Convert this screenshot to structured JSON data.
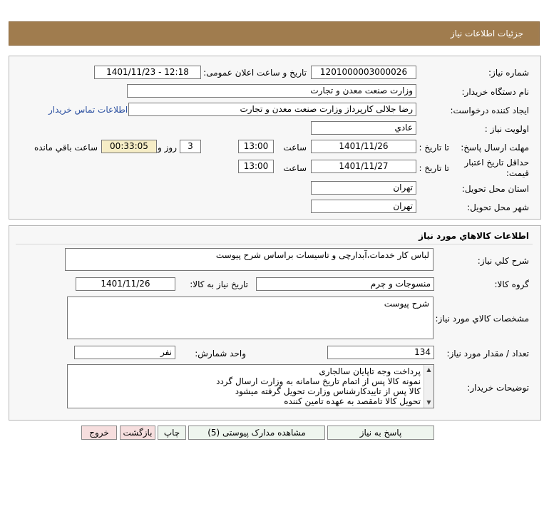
{
  "header": {
    "title": "جزئیات اطلاعات نیاز"
  },
  "details": {
    "need_number_label": "شماره نیاز:",
    "need_number": "1201000003000026",
    "announce_label": "تاریخ و ساعت اعلان عمومی:",
    "announce_value": "1401/11/23 - 12:18",
    "buyer_org_label": "نام دستگاه خریدار:",
    "buyer_org": "وزارت صنعت معدن و تجارت",
    "requester_label": "ایجاد کننده درخواست:",
    "requester": "رضا جلالی کارپرداز وزارت صنعت معدن و تجارت",
    "contact_link": "اطلاعات تماس خریدار",
    "priority_label": "اولویت نیاز :",
    "priority": "عادي",
    "deadline_label": "مهلت ارسال پاسخ:",
    "to_date_label": "تا تاریخ :",
    "deadline_date": "1401/11/26",
    "time_label": "ساعت",
    "deadline_time": "13:00",
    "days_value": "3",
    "days_label": "روز و",
    "remaining_time": "00:33:05",
    "remaining_label": "ساعت باقي مانده",
    "validity_label_1": "حداقل تاریخ اعتبار",
    "validity_label_2": "قیمت:",
    "validity_to_label": "تا تاریخ :",
    "validity_date": "1401/11/27",
    "validity_time_label": "ساعت",
    "validity_time": "13:00",
    "province_label": "استان محل تحویل:",
    "province": "تهران",
    "city_label": "شهر محل تحویل:",
    "city": "تهران"
  },
  "goods": {
    "section_title": "اطلاعات کالاهاي مورد نياز",
    "summary_label": "شرح کلي نياز:",
    "summary": "لباس کار خدمات،آبدارچی و تاسیسات براساس شرح پیوست",
    "group_label": "گروه کالا:",
    "group": "منسوجات و چرم",
    "need_date_label": "تاریخ نیاز به کالا:",
    "need_date": "1401/11/26",
    "specs_label": "مشخصات کالاي مورد نياز:",
    "specs": "شرح پیوست",
    "qty_label": "تعداد / مقدار مورد نیاز:",
    "qty": "134",
    "unit_label": "واحد شمارش:",
    "unit": "نفر",
    "buyer_notes_label": "توضیحات خریدار:",
    "buyer_notes": [
      "پرداخت وجه تاپایان سالجاری",
      "نمونه کالا پس از اتمام تاریخ سامانه به وزارت ارسال گردد",
      "کالا پس از تاییدکارشناس وزارت تحویل گرفته میشود",
      "تحویل کالا تامقصد به عهده تامین کننده"
    ]
  },
  "buttons": {
    "reply": "پاسخ به نیاز",
    "attachments": "مشاهده مدارک پیوستی (5)",
    "print": "چاپ",
    "back": "بازگشت",
    "exit": "خروج"
  },
  "colors": {
    "header_bg": "#a07c4e",
    "remaining_bg": "#f6edc6",
    "link": "#2a4fa0"
  }
}
